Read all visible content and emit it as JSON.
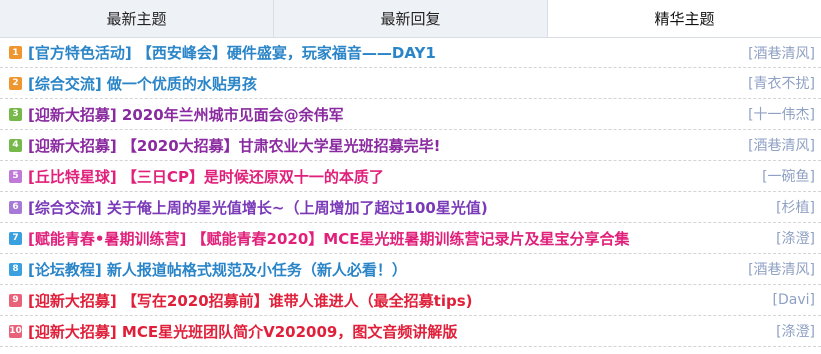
{
  "tabs": [
    {
      "label": "最新主题"
    },
    {
      "label": "最新回复"
    },
    {
      "label": "精华主题"
    }
  ],
  "active_tab": 2,
  "threads": [
    {
      "num": "1",
      "badge_color": "#f0962e",
      "title_color": "#2a85c8",
      "title": "[官方特色活动] 【西安峰会】硬件盛宴，玩家福音——DAY1",
      "author": "[酒巷清风]"
    },
    {
      "num": "2",
      "badge_color": "#f0962e",
      "title_color": "#2a85c8",
      "title": "[综合交流] 做一个优质的水贴男孩",
      "author": "[青衣不扰]"
    },
    {
      "num": "3",
      "badge_color": "#77b84a",
      "title_color": "#8a2aa0",
      "title": "[迎新大招募] 2020年兰州城市见面会@余伟军",
      "author": "[十一伟杰]"
    },
    {
      "num": "4",
      "badge_color": "#77b84a",
      "title_color": "#8a2aa0",
      "title": "[迎新大招募] 【2020大招募】甘肃农业大学星光班招募完毕!",
      "author": "[酒巷清风]"
    },
    {
      "num": "5",
      "badge_color": "#c07ad8",
      "title_color": "#e0207a",
      "title": "[丘比特星球] 【三日CP】是时候还原双十一的本质了",
      "author": "[一碗鱼]"
    },
    {
      "num": "6",
      "badge_color": "#a87ad8",
      "title_color": "#7a3ab8",
      "title": "[综合交流] 关于俺上周的星光值增长~（上周增加了超过100星光值)",
      "author": "[杉植]"
    },
    {
      "num": "7",
      "badge_color": "#3aa0e0",
      "title_color": "#e0207a",
      "title": "[赋能青春•暑期训练营] 【赋能青春2020】MCE星光班暑期训练营记录片及星宝分享合集",
      "author": "[涤澄]"
    },
    {
      "num": "8",
      "badge_color": "#3aa0e0",
      "title_color": "#2a85c8",
      "title": "[论坛教程] 新人报道帖格式规范及小任务（新人必看！）",
      "author": "[酒巷清风]"
    },
    {
      "num": "9",
      "badge_color": "#e8637a",
      "title_color": "#e0203a",
      "title": "[迎新大招募] 【写在2020招募前】谁带人谁进人（最全招募tips)",
      "author": "[Davi]"
    },
    {
      "num": "10",
      "badge_color": "#e8637a",
      "title_color": "#e0203a",
      "title": "[迎新大招募] MCE星光班团队简介V202009，图文音频讲解版",
      "author": "[涤澄]"
    }
  ]
}
